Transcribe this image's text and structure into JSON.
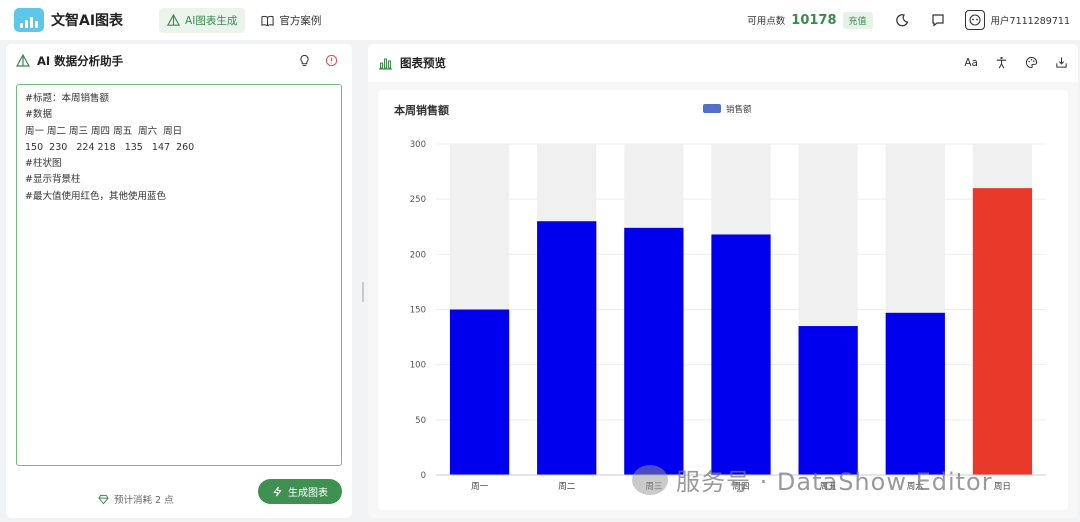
{
  "header": {
    "app_name": "文智AI图表",
    "nav": [
      {
        "label": "AI图表生成",
        "active": true
      },
      {
        "label": "官方案例",
        "active": false
      }
    ],
    "points_label": "可用点数",
    "points_value": "10178",
    "recharge_label": "充值",
    "username": "用户7111289711"
  },
  "left_panel": {
    "title": "AI 数据分析助手",
    "prompt_lines": [
      "#标题：本周销售额",
      "#数据",
      "周一 周二 周三 周四 周五  周六  周日",
      "150  230   224 218   135   147  260",
      "#柱状图",
      "#显示背景柱",
      "#最大值使用红色，其他使用蓝色"
    ],
    "cost_label": "预计消耗 2 点",
    "generate_label": "生成图表"
  },
  "right_panel": {
    "title": "图表预览",
    "font_tool_label": "Aa"
  },
  "chart_data": {
    "type": "bar",
    "title": "本周销售额",
    "legend": "top-center",
    "categories": [
      "周一",
      "周二",
      "周三",
      "周四",
      "周五",
      "周六",
      "周日"
    ],
    "series": [
      {
        "name": "销售额",
        "values": [
          150,
          230,
          224,
          218,
          135,
          147,
          260
        ]
      }
    ],
    "ylim": [
      0,
      300
    ],
    "yticks": [
      0,
      50,
      100,
      150,
      200,
      250,
      300
    ],
    "background_bar_value": 300,
    "colors": {
      "normal": "#0000ee",
      "max": "#e8392a",
      "background": "#f0f0f0",
      "legend": "#5470c6"
    }
  },
  "watermark": "服务号 · DataShow Editor"
}
